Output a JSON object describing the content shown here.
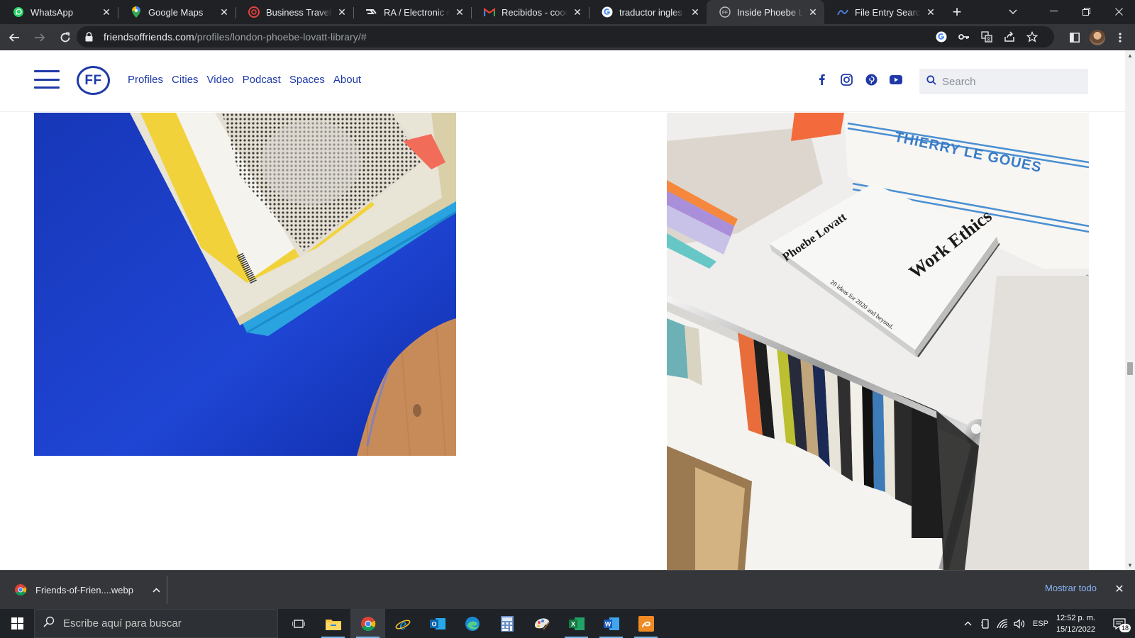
{
  "browser": {
    "tabs": [
      {
        "title": "WhatsApp",
        "icon": "whatsapp-icon",
        "active": false
      },
      {
        "title": "Google Maps",
        "icon": "google-maps-icon",
        "active": false
      },
      {
        "title": "Business Traveller M",
        "icon": "business-traveller-icon",
        "active": false
      },
      {
        "title": "RA / Electronic mu",
        "icon": "ra-icon",
        "active": false
      },
      {
        "title": "Recibidos - coocar",
        "icon": "gmail-icon",
        "active": false
      },
      {
        "title": "traductor ingles a e",
        "icon": "google-icon",
        "active": false
      },
      {
        "title": "Inside Phoebe Lova",
        "icon": "ff-icon",
        "active": true
      },
      {
        "title": "File Entry Search",
        "icon": "file-entry-icon",
        "active": false
      }
    ],
    "url_host": "friendsoffriends.com",
    "url_path": "/profiles/london-phoebe-lovatt-library/#"
  },
  "site": {
    "logo": "FF",
    "nav": [
      "Profiles",
      "Cities",
      "Video",
      "Podcast",
      "Spaces",
      "About"
    ],
    "search_placeholder": "Search",
    "socials": [
      "facebook-icon",
      "instagram-icon",
      "pinterest-icon",
      "youtube-icon"
    ],
    "book": {
      "author": "Phoebe Lovatt",
      "title": "Work Ethics",
      "subtitle": "20 ideas for 2020 and beyond.",
      "box_label": "THIERRY LE GOUÈS"
    }
  },
  "download": {
    "filename": "Friends-of-Frien....webp",
    "show_all": "Mostrar todo"
  },
  "taskbar": {
    "search_placeholder": "Escribe aquí para buscar",
    "language": "ESP",
    "time": "12:52 p. m.",
    "date": "15/12/2022",
    "notifications": "18"
  }
}
